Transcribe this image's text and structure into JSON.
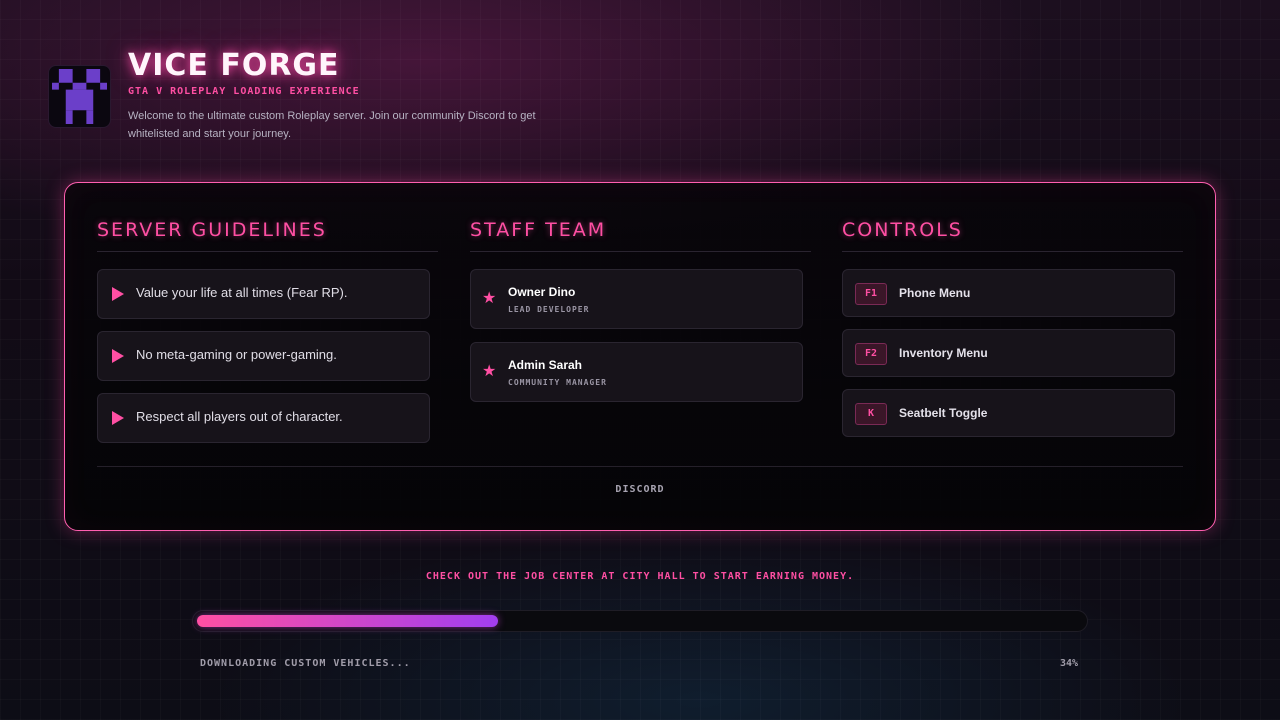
{
  "header": {
    "title": "VICE FORGE",
    "subtitle": "GTA V ROLEPLAY LOADING EXPERIENCE",
    "description": "Welcome to the ultimate custom Roleplay server. Join our community Discord to get whitelisted and start your journey.",
    "logo_icon": "creeper-logo-icon"
  },
  "colors": {
    "accent": "#ff4fa3",
    "progress_start": "#ff4fa3",
    "progress_end": "#a23ef0"
  },
  "guidelines": {
    "title": "SERVER GUIDELINES",
    "items": [
      "Value your life at all times (Fear RP).",
      "No meta-gaming or power-gaming.",
      "Respect all players out of character."
    ]
  },
  "staff": {
    "title": "STAFF TEAM",
    "members": [
      {
        "name": "Owner Dino",
        "role": "LEAD DEVELOPER"
      },
      {
        "name": "Admin Sarah",
        "role": "COMMUNITY MANAGER"
      }
    ]
  },
  "controls": {
    "title": "CONTROLS",
    "items": [
      {
        "key": "F1",
        "label": "Phone Menu"
      },
      {
        "key": "F2",
        "label": "Inventory Menu"
      },
      {
        "key": "K",
        "label": "Seatbelt Toggle"
      }
    ]
  },
  "discord_label": "DISCORD",
  "tip": "CHECK OUT THE JOB CENTER AT CITY HALL TO START EARNING MONEY.",
  "loading": {
    "status": "DOWNLOADING CUSTOM VEHICLES...",
    "percent_label": "34%",
    "progress": 0.34
  }
}
